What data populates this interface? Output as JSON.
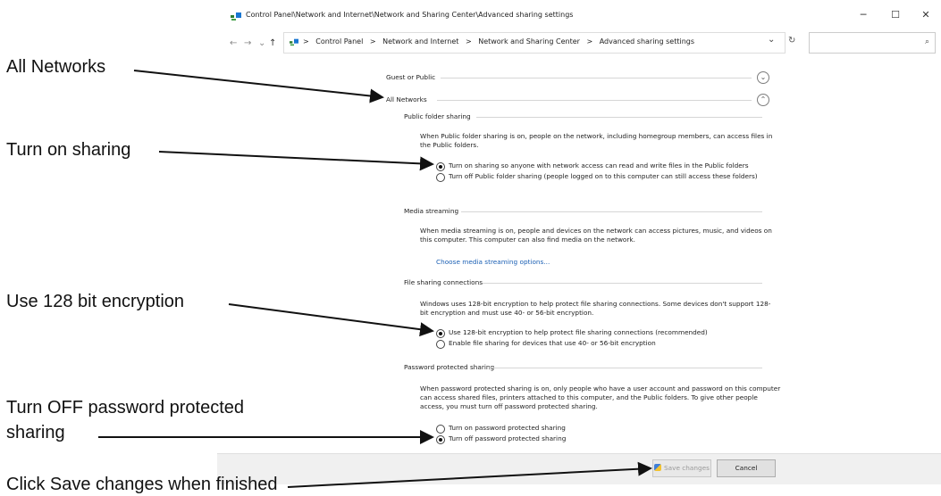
{
  "window": {
    "title": "Control Panel\\Network and Internet\\Network and Sharing Center\\Advanced sharing settings",
    "minimize": "─",
    "maximize": "☐",
    "close": "✕"
  },
  "address": {
    "breadcrumbs": [
      "Control Panel",
      "Network and Internet",
      "Network and Sharing Center",
      "Advanced sharing settings"
    ],
    "separator": ">",
    "dropdown": "⌄",
    "refresh": "↻",
    "search_placeholder": "",
    "search_icon": "⌕"
  },
  "nav": {
    "back": "←",
    "forward": "→",
    "recent": "⌄",
    "up": "↑"
  },
  "sections": {
    "guest_public": "Guest or Public",
    "all_networks": "All Networks",
    "chevron_down": "⌄",
    "chevron_up": "⌃"
  },
  "public_folder": {
    "header": "Public folder sharing",
    "desc": "When Public folder sharing is on, people on the network, including homegroup members, can access files in the Public folders.",
    "opt_on": "Turn on sharing so anyone with network access can read and write files in the Public folders",
    "opt_off": "Turn off Public folder sharing (people logged on to this computer can still access these folders)"
  },
  "media": {
    "header": "Media streaming",
    "desc": "When media streaming is on, people and devices on the network can access pictures, music, and videos on this computer. This computer can also find media on the network.",
    "link": "Choose media streaming options..."
  },
  "file_sharing": {
    "header": "File sharing connections",
    "desc": "Windows uses 128-bit encryption to help protect file sharing connections. Some devices don't support 128-bit encryption and must use 40- or 56-bit encryption.",
    "opt_128": "Use 128-bit encryption to help protect file sharing connections (recommended)",
    "opt_40": "Enable file sharing for devices that use 40- or 56-bit encryption"
  },
  "password": {
    "header": "Password protected sharing",
    "desc": "When password protected sharing is on, only people who have a user account and password on this computer can access shared files, printers attached to this computer, and the Public folders. To give other people access, you must turn off password protected sharing.",
    "opt_on": "Turn on password protected sharing",
    "opt_off": "Turn off password protected sharing"
  },
  "buttons": {
    "save": "Save changes",
    "cancel": "Cancel"
  },
  "annotations": {
    "all_networks": "All Networks",
    "turn_on_sharing": "Turn on sharing",
    "use_128": "Use 128 bit encryption",
    "turn_off_pw_1": "Turn OFF password protected",
    "turn_off_pw_2": "sharing",
    "save": "Click Save changes when finished"
  }
}
